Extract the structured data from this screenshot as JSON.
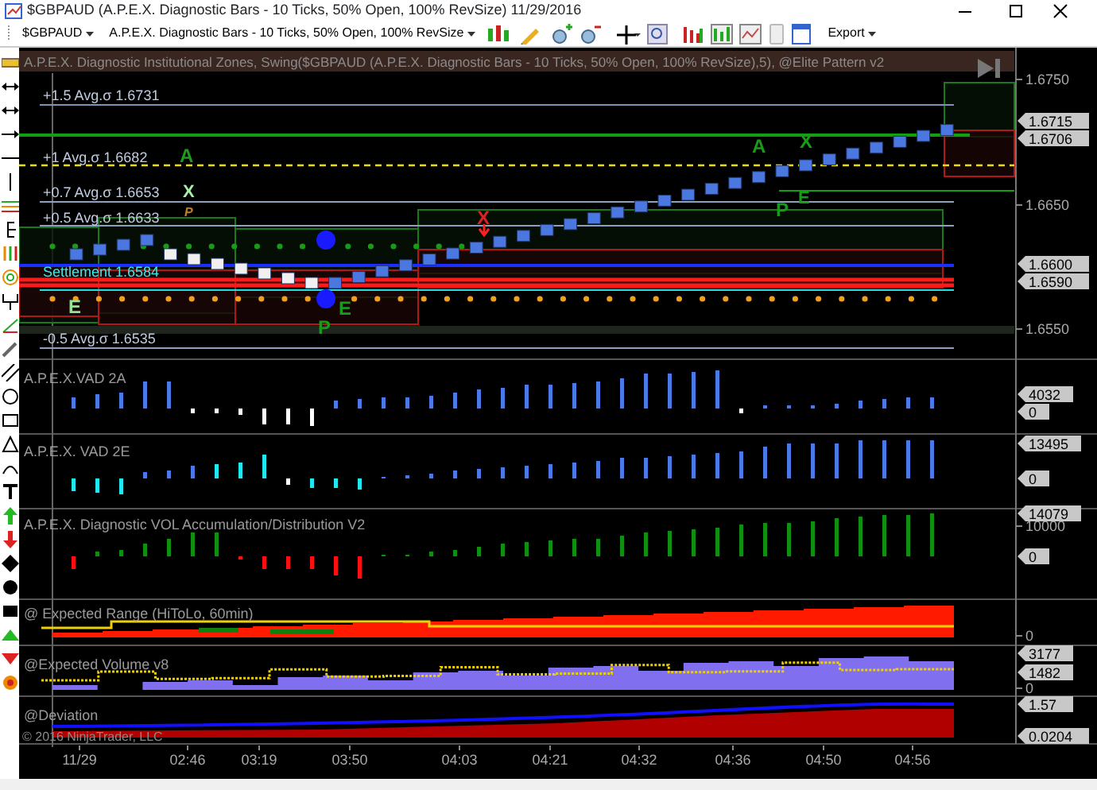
{
  "window": {
    "title": "$GBPAUD (A.P.E.X. Diagnostic Bars - 10 Ticks, 50% Open, 100% RevSize)  11/29/2016"
  },
  "toolbar": {
    "instrument": "$GBPAUD",
    "bar_type": "A.P.E.X. Diagnostic Bars - 10 Ticks, 50% Open, 100% RevSize",
    "export": "Export"
  },
  "price_panel": {
    "title": "A.P.E.X. Diagnostic Institutional Zones, Swing($GBPAUD (A.P.E.X. Diagnostic Bars - 10 Ticks, 50% Open, 100% RevSize),5), @Elite Pattern v2",
    "levels": [
      {
        "label": "+1.5 Avg.σ 1.6731",
        "kind": "sigma"
      },
      {
        "label": "+1 Avg.σ 1.6682",
        "kind": "sigma"
      },
      {
        "label": "+0.7 Avg.σ 1.6653",
        "kind": "sigma"
      },
      {
        "label": "+0.5 Avg.σ 1.6633",
        "kind": "sigma"
      },
      {
        "label": "Settlement 1.6584",
        "kind": "settlement"
      },
      {
        "label": "-0.5 Avg.σ 1.6535",
        "kind": "sigma"
      }
    ],
    "pattern_letters": [
      {
        "text": "A",
        "color": "#1f9a1f"
      },
      {
        "text": "X",
        "color": "#a8f0a8"
      },
      {
        "text": "P",
        "color": "#c08020"
      },
      {
        "text": "E",
        "color": "#98e098"
      },
      {
        "text": "P",
        "color": "#1a9a1a"
      },
      {
        "text": "E",
        "color": "#1a9a1a"
      },
      {
        "text": "X",
        "color": "#e02020"
      },
      {
        "text": "A",
        "color": "#1a9a1a"
      },
      {
        "text": "X",
        "color": "#1a9a1a"
      },
      {
        "text": "E",
        "color": "#1a9a1a"
      },
      {
        "text": "P",
        "color": "#1a9a1a"
      }
    ],
    "axis_ticks": [
      "1.6750",
      "1.6650",
      "1.6550"
    ],
    "price_flags": [
      "1.6715",
      "1.6706",
      "1.6600",
      "1.6590"
    ]
  },
  "indicator_panels": [
    {
      "title": "A.P.E.X.VAD 2A",
      "kind": "vad2a",
      "flags": [
        "4032",
        "0"
      ]
    },
    {
      "title": "A.P.E.X. VAD 2E",
      "kind": "vad2e",
      "flags": [
        "13495",
        "0"
      ]
    },
    {
      "title": "A.P.E.X. Diagnostic VOL Accumulation/Distribution V2",
      "kind": "accdist",
      "flags": [
        "14079",
        "0"
      ],
      "axis_ticks": [
        "10000"
      ]
    },
    {
      "title": "@ Expected Range (HiToLo, 60min)",
      "kind": "range",
      "axis_ticks": [
        "0"
      ]
    },
    {
      "title": "@Expected Volume v8",
      "kind": "expvolume",
      "flags": [
        "3177",
        "1482"
      ],
      "axis_ticks": [
        "0"
      ]
    },
    {
      "title": "@Deviation",
      "kind": "deviation",
      "flags": [
        "1.57",
        "0.0204"
      ]
    }
  ],
  "copyright": "© 2016 NinjaTrader, LLC",
  "time_axis": [
    "11/29",
    "02:46",
    "03:19",
    "03:50",
    "04:03",
    "04:21",
    "04:32",
    "04:36",
    "04:50",
    "04:56"
  ]
}
